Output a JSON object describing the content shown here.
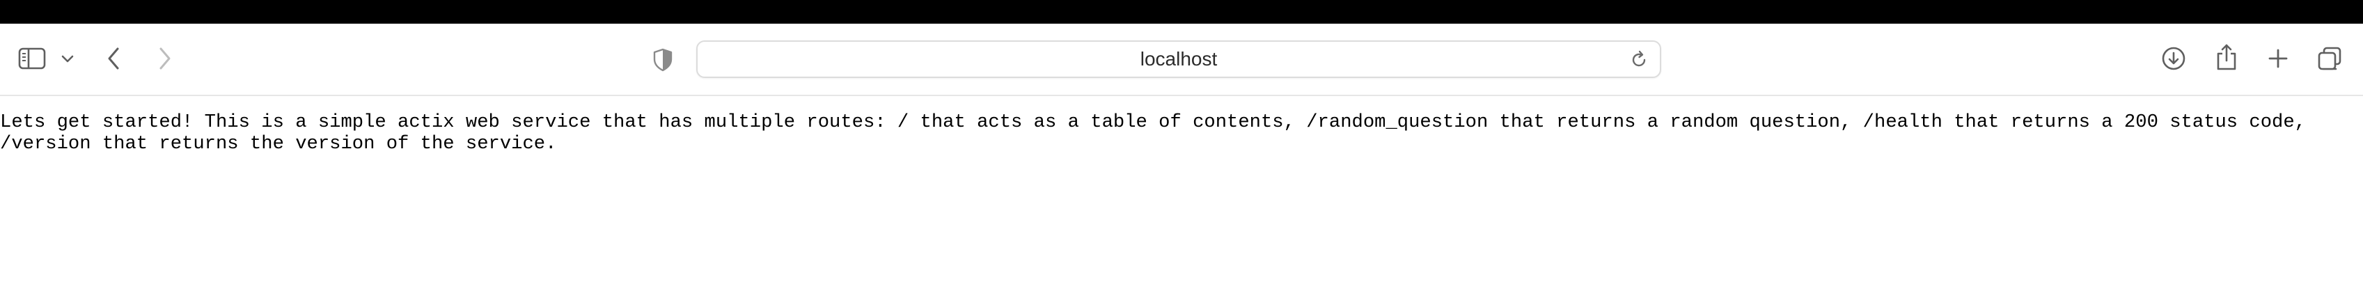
{
  "browser": {
    "address_bar": {
      "url_text": "localhost"
    },
    "icons": {
      "sidebar": "sidebar-icon",
      "sidebar_menu": "chevron-down-icon",
      "back": "chevron-left-icon",
      "forward": "chevron-right-icon",
      "privacy": "shield-icon",
      "reload": "reload-icon",
      "downloads": "download-icon",
      "share": "share-icon",
      "new_tab": "plus-icon",
      "tab_overview": "tabs-overview-icon"
    },
    "colors": {
      "top_bar": "#000000",
      "icon": "#5f5f5f",
      "icon_disabled": "#bdbdbd"
    }
  },
  "page": {
    "text": "Lets get started! This is a simple actix web service that has multiple routes: / that acts as a table of contents, /random_question that returns a random question, /health that returns a 200 status code, /version that returns the version of the service."
  }
}
